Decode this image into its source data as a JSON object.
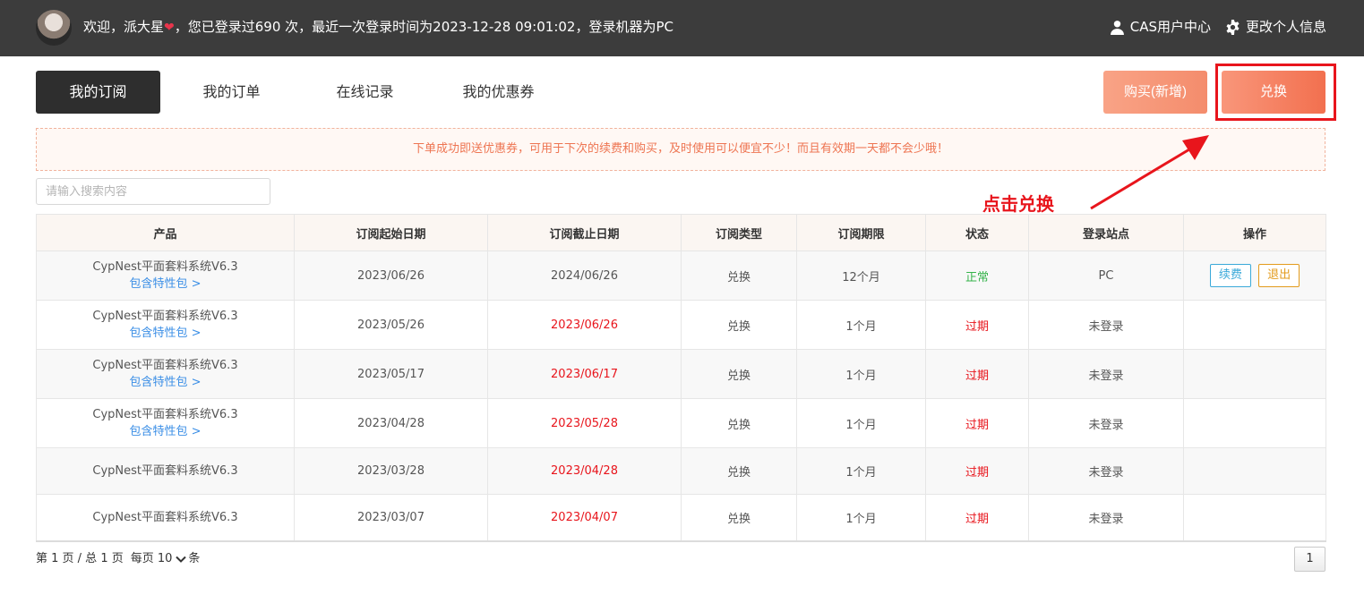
{
  "header": {
    "welcome_prefix": "欢迎，派大星",
    "welcome_suffix": "，您已登录过690 次，最近一次登录时间为2023-12-28 09:01:02，登录机器为PC",
    "links": [
      {
        "label": "CAS用户中心",
        "icon": "user-icon"
      },
      {
        "label": "更改个人信息",
        "icon": "gear-icon"
      }
    ]
  },
  "tabs": [
    {
      "label": "我的订阅",
      "active": true
    },
    {
      "label": "我的订单",
      "active": false
    },
    {
      "label": "在线记录",
      "active": false
    },
    {
      "label": "我的优惠券",
      "active": false
    }
  ],
  "actions": {
    "buy_label": "购买(新增)",
    "redeem_label": "兑换"
  },
  "notice": "下单成功即送优惠券，可用于下次的续费和购买，及时使用可以便宜不少！而且有效期一天都不会少哦！",
  "search": {
    "placeholder": "请输入搜索内容",
    "value": ""
  },
  "annotation": {
    "label": "点击兑换",
    "color": "#e8151c"
  },
  "table": {
    "columns": [
      "产品",
      "订阅起始日期",
      "订阅截止日期",
      "订阅类型",
      "订阅期限",
      "状态",
      "登录站点",
      "操作"
    ],
    "rows": [
      {
        "product": "CypNest平面套料系统V6.3",
        "feature": "包含特性包 >",
        "start": "2023/06/26",
        "end": "2024/06/26",
        "type": "兑换",
        "period": "12个月",
        "status": "正常",
        "site": "PC",
        "ops": [
          "续费",
          "退出"
        ]
      },
      {
        "product": "CypNest平面套料系统V6.3",
        "feature": "包含特性包 >",
        "start": "2023/05/26",
        "end": "2023/06/26",
        "type": "兑换",
        "period": "1个月",
        "status": "过期",
        "site": "未登录",
        "ops": []
      },
      {
        "product": "CypNest平面套料系统V6.3",
        "feature": "包含特性包 >",
        "start": "2023/05/17",
        "end": "2023/06/17",
        "type": "兑换",
        "period": "1个月",
        "status": "过期",
        "site": "未登录",
        "ops": []
      },
      {
        "product": "CypNest平面套料系统V6.3",
        "feature": "包含特性包 >",
        "start": "2023/04/28",
        "end": "2023/05/28",
        "type": "兑换",
        "period": "1个月",
        "status": "过期",
        "site": "未登录",
        "ops": []
      },
      {
        "product": "CypNest平面套料系统V6.3",
        "feature": "",
        "start": "2023/03/28",
        "end": "2023/04/28",
        "type": "兑换",
        "period": "1个月",
        "status": "过期",
        "site": "未登录",
        "ops": []
      },
      {
        "product": "CypNest平面套料系统V6.3",
        "feature": "",
        "start": "2023/03/07",
        "end": "2023/04/07",
        "type": "兑换",
        "period": "1个月",
        "status": "过期",
        "site": "未登录",
        "ops": []
      }
    ]
  },
  "pagination": {
    "info": "第 1 页 / 总 1 页",
    "per_page_label": "每页",
    "per_page_value": "10",
    "unit": "条",
    "current_page": "1"
  },
  "colors": {
    "header_bg": "#3c3c3c",
    "accent": "#f2704f",
    "expired": "#e8151c",
    "normal": "#36b34b",
    "link": "#3a8ee6"
  }
}
